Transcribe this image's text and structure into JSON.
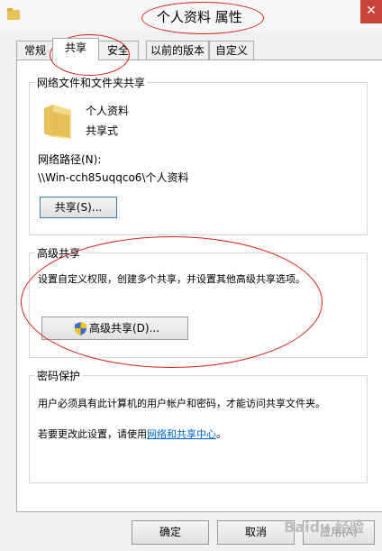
{
  "window": {
    "title": "个人资料 属性",
    "close_glyph": "✕"
  },
  "tabs": [
    {
      "label": "常规"
    },
    {
      "label": "共享"
    },
    {
      "label": "安全"
    },
    {
      "label": "以前的版本"
    },
    {
      "label": "自定义"
    }
  ],
  "network_sharing": {
    "group_title": "网络文件和文件夹共享",
    "folder_name": "个人资料",
    "share_status": "共享式",
    "path_label": "网络路径(N):",
    "path_value": "\\\\Win-cch85uqqco6\\个人资料",
    "share_button": "共享(S)..."
  },
  "advanced_sharing": {
    "group_title": "高级共享",
    "description": "设置自定义权限，创建多个共享，并设置其他高级共享选项。",
    "button": "高级共享(D)..."
  },
  "password_protection": {
    "group_title": "密码保护",
    "description": "用户必须具有此计算机的用户帐户和密码，才能访问共享文件夹。",
    "change_prefix": "若要更改此设置，请使用",
    "change_link": "网络和共享中心",
    "change_suffix": "。"
  },
  "footer": {
    "ok": "确定",
    "cancel": "取消",
    "apply": "应用(A)"
  },
  "watermark": "Baidu 经验"
}
